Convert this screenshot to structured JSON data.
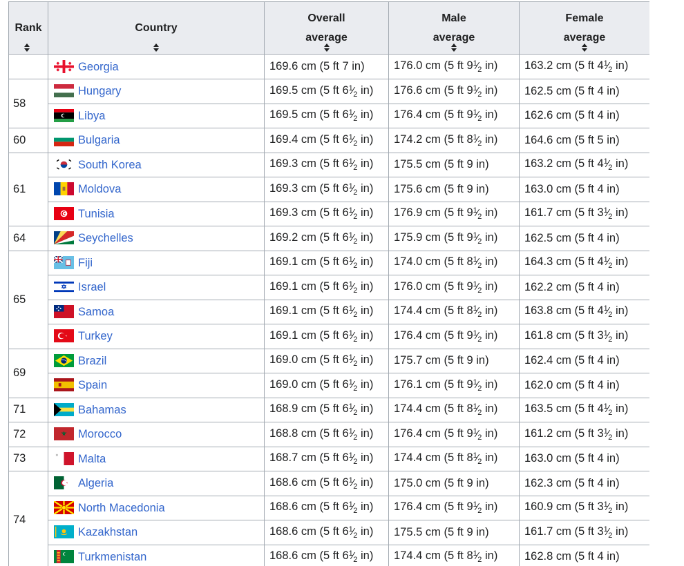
{
  "headers": {
    "rank": "Rank",
    "country": "Country",
    "overall": [
      "Overall",
      "average"
    ],
    "male": [
      "Male",
      "average"
    ],
    "female": [
      "Female",
      "average"
    ]
  },
  "rows": [
    {
      "country": "Georgia",
      "flag": "georgia-flag",
      "overall": "169.6 cm (5 ft 7 in)",
      "male": "176.0 cm (5 ft 9½ in)",
      "female": "163.2 cm (5 ft 4½ in)"
    },
    {
      "country": "Hungary",
      "flag": "hungary-flag",
      "overall": "169.5 cm (5 ft 6½ in)",
      "male": "176.6 cm (5 ft 9½ in)",
      "female": "162.5 cm (5 ft 4 in)"
    },
    {
      "country": "Libya",
      "flag": "libya-flag",
      "overall": "169.5 cm (5 ft 6½ in)",
      "male": "176.4 cm (5 ft 9½ in)",
      "female": "162.6 cm (5 ft 4 in)"
    },
    {
      "country": "Bulgaria",
      "flag": "bulgaria-flag",
      "overall": "169.4 cm (5 ft 6½ in)",
      "male": "174.2 cm (5 ft 8½ in)",
      "female": "164.6 cm (5 ft 5 in)"
    },
    {
      "country": "South Korea",
      "flag": "south-korea-flag",
      "overall": "169.3 cm (5 ft 6½ in)",
      "male": "175.5 cm (5 ft 9 in)",
      "female": "163.2 cm (5 ft 4½ in)"
    },
    {
      "country": "Moldova",
      "flag": "moldova-flag",
      "overall": "169.3 cm (5 ft 6½ in)",
      "male": "175.6 cm (5 ft 9 in)",
      "female": "163.0 cm (5 ft 4 in)"
    },
    {
      "country": "Tunisia",
      "flag": "tunisia-flag",
      "overall": "169.3 cm (5 ft 6½ in)",
      "male": "176.9 cm (5 ft 9½ in)",
      "female": "161.7 cm (5 ft 3½ in)"
    },
    {
      "country": "Seychelles",
      "flag": "seychelles-flag",
      "overall": "169.2 cm (5 ft 6½ in)",
      "male": "175.9 cm (5 ft 9½ in)",
      "female": "162.5 cm (5 ft 4 in)"
    },
    {
      "country": "Fiji",
      "flag": "fiji-flag",
      "overall": "169.1 cm (5 ft 6½ in)",
      "male": "174.0 cm (5 ft 8½ in)",
      "female": "164.3 cm (5 ft 4½ in)"
    },
    {
      "country": "Israel",
      "flag": "israel-flag",
      "overall": "169.1 cm (5 ft 6½ in)",
      "male": "176.0 cm (5 ft 9½ in)",
      "female": "162.2 cm (5 ft 4 in)"
    },
    {
      "country": "Samoa",
      "flag": "samoa-flag",
      "overall": "169.1 cm (5 ft 6½ in)",
      "male": "174.4 cm (5 ft 8½ in)",
      "female": "163.8 cm (5 ft 4½ in)"
    },
    {
      "country": "Turkey",
      "flag": "turkey-flag",
      "overall": "169.1 cm (5 ft 6½ in)",
      "male": "176.4 cm (5 ft 9½ in)",
      "female": "161.8 cm (5 ft 3½ in)"
    },
    {
      "country": "Brazil",
      "flag": "brazil-flag",
      "overall": "169.0 cm (5 ft 6½ in)",
      "male": "175.7 cm (5 ft 9 in)",
      "female": "162.4 cm (5 ft 4 in)"
    },
    {
      "country": "Spain",
      "flag": "spain-flag",
      "overall": "169.0 cm (5 ft 6½ in)",
      "male": "176.1 cm (5 ft 9½ in)",
      "female": "162.0 cm (5 ft 4 in)"
    },
    {
      "country": "Bahamas",
      "flag": "bahamas-flag",
      "overall": "168.9 cm (5 ft 6½ in)",
      "male": "174.4 cm (5 ft 8½ in)",
      "female": "163.5 cm (5 ft 4½ in)"
    },
    {
      "country": "Morocco",
      "flag": "morocco-flag",
      "overall": "168.8 cm (5 ft 6½ in)",
      "male": "176.4 cm (5 ft 9½ in)",
      "female": "161.2 cm (5 ft 3½ in)"
    },
    {
      "country": "Malta",
      "flag": "malta-flag",
      "overall": "168.7 cm (5 ft 6½ in)",
      "male": "174.4 cm (5 ft 8½ in)",
      "female": "163.0 cm (5 ft 4 in)"
    },
    {
      "country": "Algeria",
      "flag": "algeria-flag",
      "overall": "168.6 cm (5 ft 6½ in)",
      "male": "175.0 cm (5 ft 9 in)",
      "female": "162.3 cm (5 ft 4 in)"
    },
    {
      "country": "North Macedonia",
      "flag": "north-macedonia-flag",
      "overall": "168.6 cm (5 ft 6½ in)",
      "male": "176.4 cm (5 ft 9½ in)",
      "female": "160.9 cm (5 ft 3½ in)"
    },
    {
      "country": "Kazakhstan",
      "flag": "kazakhstan-flag",
      "overall": "168.6 cm (5 ft 6½ in)",
      "male": "175.5 cm (5 ft 9 in)",
      "female": "161.7 cm (5 ft 3½ in)"
    },
    {
      "country": "Turkmenistan",
      "flag": "turkmenistan-flag",
      "overall": "168.6 cm (5 ft 6½ in)",
      "male": "174.4 cm (5 ft 8½ in)",
      "female": "162.8 cm (5 ft 4 in)"
    }
  ],
  "rank_groups": [
    {
      "rank": "",
      "span": 1
    },
    {
      "rank": "58",
      "span": 2
    },
    {
      "rank": "60",
      "span": 1
    },
    {
      "rank": "61",
      "span": 3
    },
    {
      "rank": "64",
      "span": 1
    },
    {
      "rank": "65",
      "span": 4
    },
    {
      "rank": "69",
      "span": 2
    },
    {
      "rank": "71",
      "span": 1
    },
    {
      "rank": "72",
      "span": 1
    },
    {
      "rank": "73",
      "span": 1
    },
    {
      "rank": "74",
      "span": 4
    }
  ],
  "colors": {
    "link": "#3366cc",
    "header_bg": "#eaecf0",
    "border": "#a2a9b1"
  }
}
